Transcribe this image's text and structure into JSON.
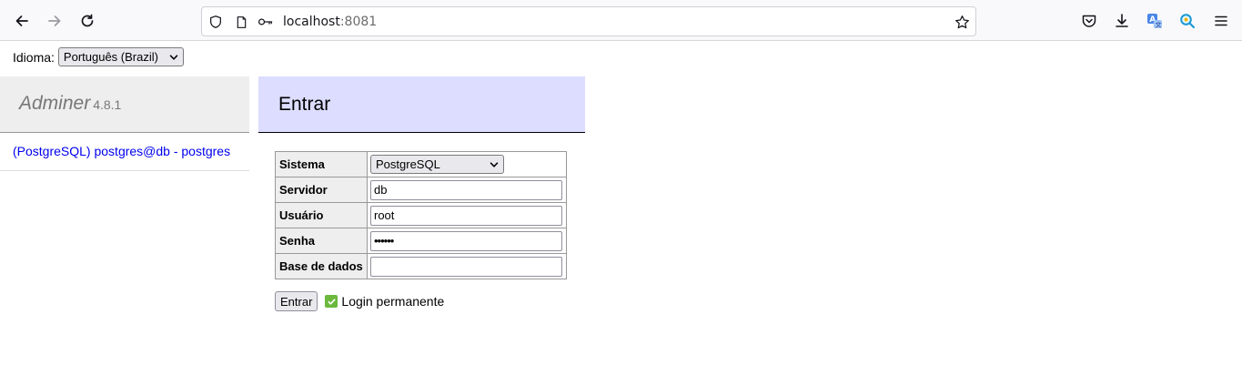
{
  "browser": {
    "url_host": "localhost",
    "url_port": ":8081"
  },
  "language": {
    "label": "Idioma:",
    "selected": "Português (Brazil)"
  },
  "sidebar": {
    "app_name": "Adminer",
    "version": "4.8.1",
    "link_label": "(PostgreSQL) postgres@db - postgres"
  },
  "content": {
    "title": "Entrar"
  },
  "form": {
    "rows": [
      {
        "label": "Sistema",
        "value": "PostgreSQL"
      },
      {
        "label": "Servidor",
        "value": "db"
      },
      {
        "label": "Usuário",
        "value": "root"
      },
      {
        "label": "Senha",
        "value": "••••••"
      },
      {
        "label": "Base de dados",
        "value": ""
      }
    ],
    "submit_label": "Entrar",
    "permanent_label": "Login permanente"
  },
  "colors": {
    "content_header": "#ddddff",
    "sidebar_header": "#eeeeee",
    "link": "#0000ee",
    "checkbox": "#6cb83d"
  }
}
